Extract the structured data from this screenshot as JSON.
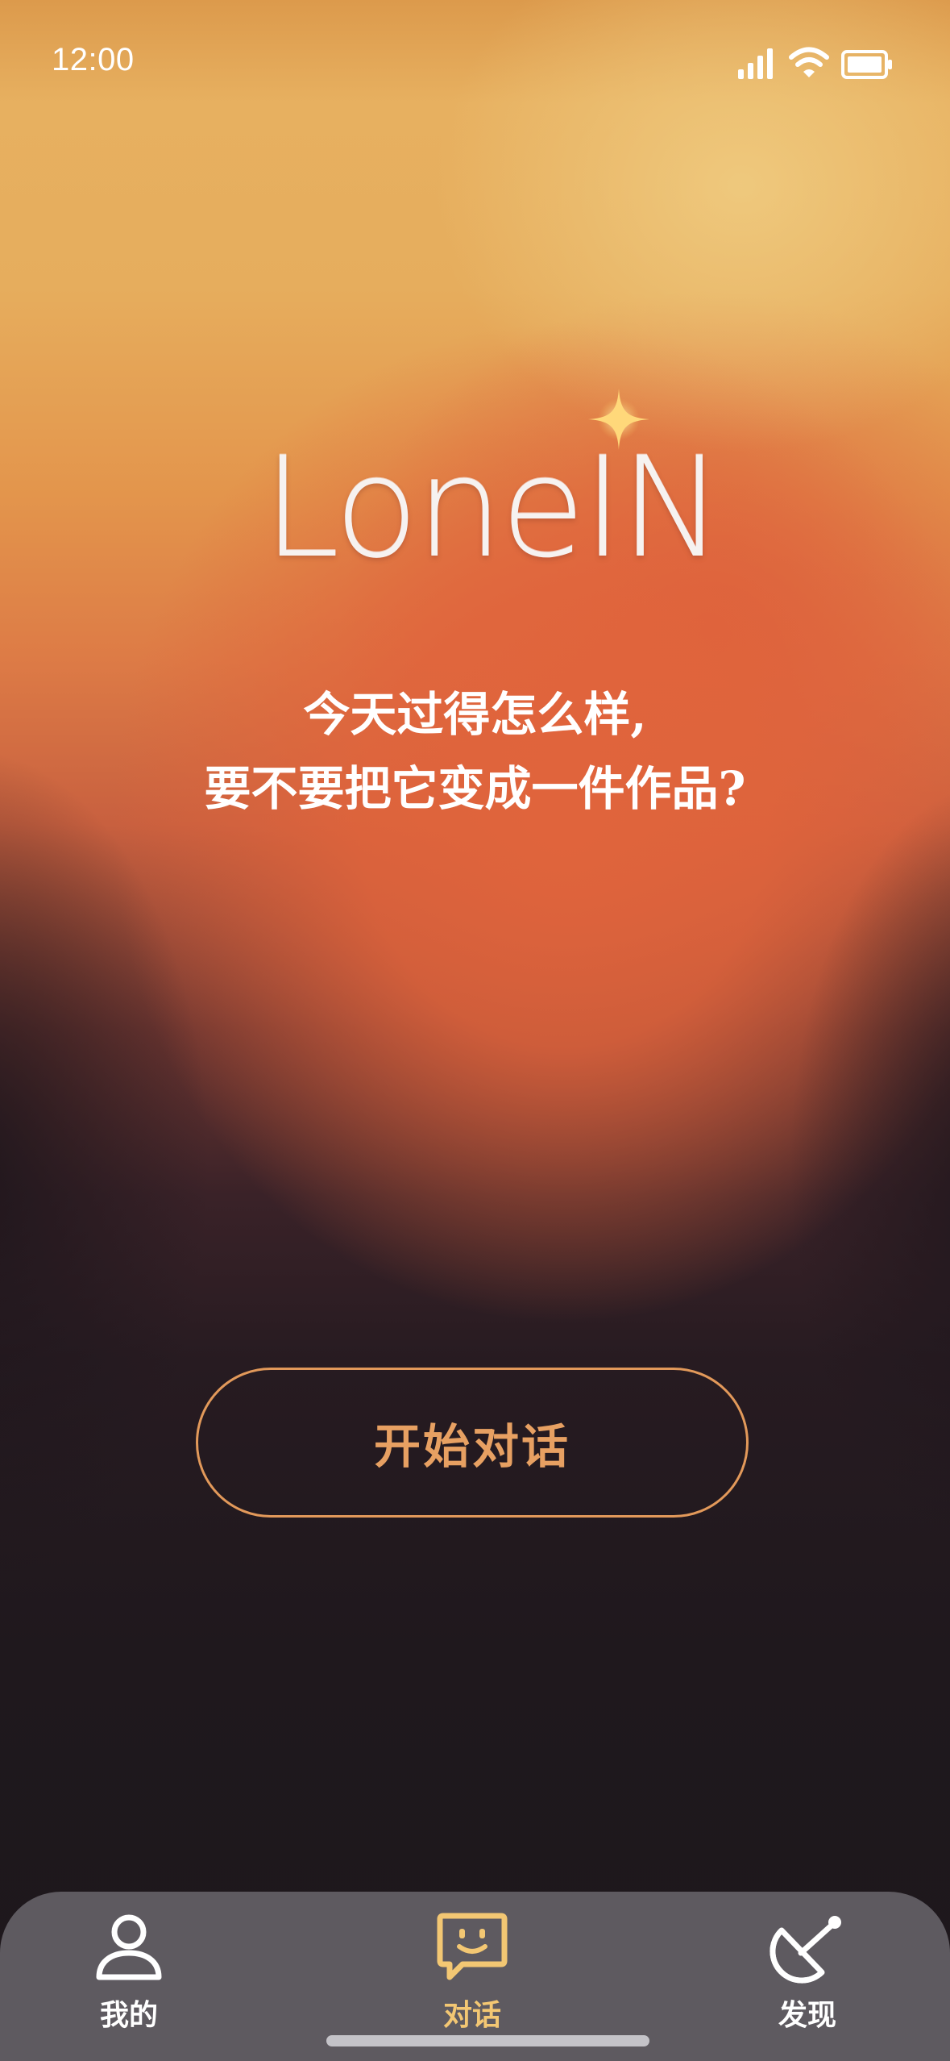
{
  "status_bar": {
    "time": "12:00",
    "icons": [
      "signal-icon",
      "wifi-icon",
      "battery-icon"
    ]
  },
  "logo": {
    "text": "LoneIN",
    "icon": "sparkle-icon"
  },
  "headline": {
    "line1": "今天过得怎么样,",
    "line2": "要不要把它变成一件作品?"
  },
  "cta": {
    "label": "开始对话"
  },
  "tab_bar": {
    "items": [
      {
        "label": "我的",
        "icon": "person-icon",
        "active": false
      },
      {
        "label": "对话",
        "icon": "chat-smile-icon",
        "active": true
      },
      {
        "label": "发现",
        "icon": "satellite-dish-icon",
        "active": false
      }
    ]
  },
  "colors": {
    "accent": "#e7a062",
    "active_tab": "#f3c773",
    "tab_bar_bg": "#5e5a60",
    "background_dark": "#1f181d",
    "gradient_orange": "#e0643c",
    "gradient_gold": "#e7b060"
  }
}
